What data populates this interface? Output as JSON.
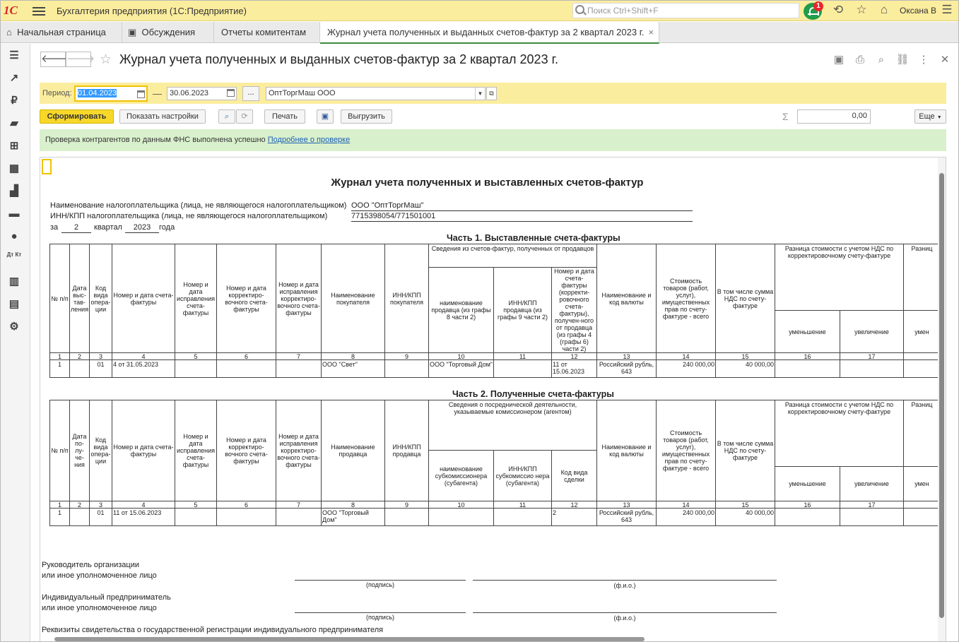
{
  "titlebar": {
    "logo": "1С",
    "title": "Бухгалтерия предприятия  (1С:Предприятие)",
    "search_placeholder": "Поиск Ctrl+Shift+F",
    "notification_count": "1",
    "user": "Оксана В"
  },
  "tabs": [
    {
      "label": "Начальная страница",
      "icon": "home-icon"
    },
    {
      "label": "Обсуждения",
      "icon": "chat-icon"
    },
    {
      "label": "Отчеты комитентам"
    },
    {
      "label": "Журнал учета полученных и выданных счетов-фактур за 2 квартал 2023 г.",
      "active": true,
      "close": "×"
    }
  ],
  "sidebar": [
    "menu-icon",
    "trend-icon",
    "ruble-icon",
    "bag-icon",
    "cart-icon",
    "grid-icon",
    "factory-icon",
    "truck-icon",
    "person-icon",
    "dt-kt-icon",
    "chart-icon",
    "books-icon",
    "gear-icon"
  ],
  "sidebar_dtkt": "Дт Кт",
  "page": {
    "title": "Журнал учета полученных и выданных счетов-фактур за 2 квартал 2023 г."
  },
  "period": {
    "label": "Период:",
    "from": "01.04.2023",
    "dash": "—",
    "to": "30.06.2023",
    "more": "...",
    "org": "ОптТоргМаш ООО"
  },
  "toolbar": {
    "generate": "Сформировать",
    "settings": "Показать настройки",
    "print": "Печать",
    "export": "Выгрузить",
    "sum_symbol": "Σ",
    "sum_value": "0,00",
    "more": "Еще"
  },
  "message": {
    "text": "Проверка контрагентов по данным ФНС выполнена успешно",
    "link": "Подробнее о проверке"
  },
  "report": {
    "title": "Журнал учета полученных и выставленных счетов-фактур",
    "taxpayer_label": "Наименование налогоплательщика (лица, не являющегося налогоплательщиком)",
    "taxpayer_value": "ООО \"ОптТоргМаш\"",
    "inn_label": "ИНН/КПП налогоплательщика (лица, не являющегося налогоплательщиком)",
    "inn_value": "7715398054/771501001",
    "za": "за",
    "quarter_num": "2",
    "quarter_word": "квартал",
    "year": "2023",
    "year_word": "года",
    "part1": {
      "title": "Часть 1. Выставленные счета-фактуры",
      "headers": [
        "№ п/п",
        "Дата выс-тав-ления",
        "Код вида опера-ции",
        "Номер и дата счета-фактуры",
        "Номер и дата исправления счета-фактуры",
        "Номер и дата корректиро-вочного счета-фактуры",
        "Номер и дата исправления корректиро-вочного счета-фактуры",
        "Наименование покупателя",
        "ИНН/КПП покупателя"
      ],
      "group_header": "Сведения из счетов-фактур, полученных от продавцов",
      "sub_headers": [
        "наименование продавца (из графы 8 части 2)",
        "ИНН/КПП продавца (из графы 9 части 2)",
        "Номер и дата счета-фактуры (корректи-ровочного счета-фактуры), получен-ного от продавца (из графы 4 (графы 6) части 2)"
      ],
      "tail_headers": [
        "Наименование и код валюты",
        "Стоимость товаров (работ, услуг), имущественных прав по счету-фактуре - всего",
        "В том числе сумма НДС по счету-фактуре"
      ],
      "diff_header": "Разница стоимости с учетом НДС по корректировочному счету-фактуре",
      "diff_sub": [
        "уменьшение",
        "увеличение"
      ],
      "diff2_header": "Разниц",
      "diff2_sub": "умен",
      "nums": [
        "1",
        "2",
        "3",
        "4",
        "5",
        "6",
        "7",
        "8",
        "9",
        "10",
        "11",
        "12",
        "13",
        "14",
        "15",
        "16",
        "17",
        ""
      ],
      "row": [
        "1",
        "",
        "01",
        "4 от 31.05.2023",
        "",
        "",
        "",
        "ООО \"Свет\"",
        "",
        "ООО \"Торговый Дом\"",
        "",
        "11 от 15.06.2023",
        "Российский рубль, 643",
        "240 000,00",
        "40 000,00",
        "",
        "",
        ""
      ]
    },
    "part2": {
      "title": "Часть 2. Полученные счета-фактуры",
      "headers": [
        "№ п/п",
        "Дата по-лу-че-ния",
        "Код вида опера-ции",
        "Номер и дата счета-фактуры",
        "Номер и дата исправления счета-фактуры",
        "Номер и дата корректиро-вочного счета-фактуры",
        "Номер и дата исправления корректиро-вочного счета-фактуры",
        "Наименование продавца",
        "ИНН/КПП продавца"
      ],
      "group_header": "Сведения о посреднической деятельности, указываемые комиссионером (агентом)",
      "sub_headers": [
        "наименование субкомиссионера (субагента)",
        "ИНН/КПП субкомиссио нера (субагента)",
        "Код вида сделки"
      ],
      "tail_headers": [
        "Наименование и код валюты",
        "Стоимость товаров (работ, услуг), имущественных прав по счету-фактуре - всего",
        "В том числе сумма НДС по счету-фактуре"
      ],
      "diff_header": "Разница стоимости с учетом НДС по корректировочному счету-фактуре",
      "diff_sub": [
        "уменьшение",
        "увеличение"
      ],
      "diff2_header": "Разниц",
      "diff2_sub": "умен",
      "nums": [
        "1",
        "2",
        "3",
        "4",
        "5",
        "6",
        "7",
        "8",
        "9",
        "10",
        "11",
        "12",
        "13",
        "14",
        "15",
        "16",
        "17",
        ""
      ],
      "row": [
        "1",
        "",
        "01",
        "11 от 15.06.2023",
        "",
        "",
        "",
        "ООО \"Торговый Дом\"",
        "",
        "",
        "",
        "2",
        "Российский рубль, 643",
        "240 000,00",
        "40 000,00",
        "",
        "",
        ""
      ]
    },
    "sign1_l1": "Руководитель организации",
    "sign1_l2": "или иное уполномоченное лицо",
    "sign2_l1": "Индивидуальный предприниматель",
    "sign2_l2": "или иное уполномоченное лицо",
    "sign_caption": "(подпись)",
    "fio_caption": "(ф.и.о.)",
    "requisites": "Реквизиты свидетельства о государственной регистрации индивидуального предпринимателя"
  }
}
